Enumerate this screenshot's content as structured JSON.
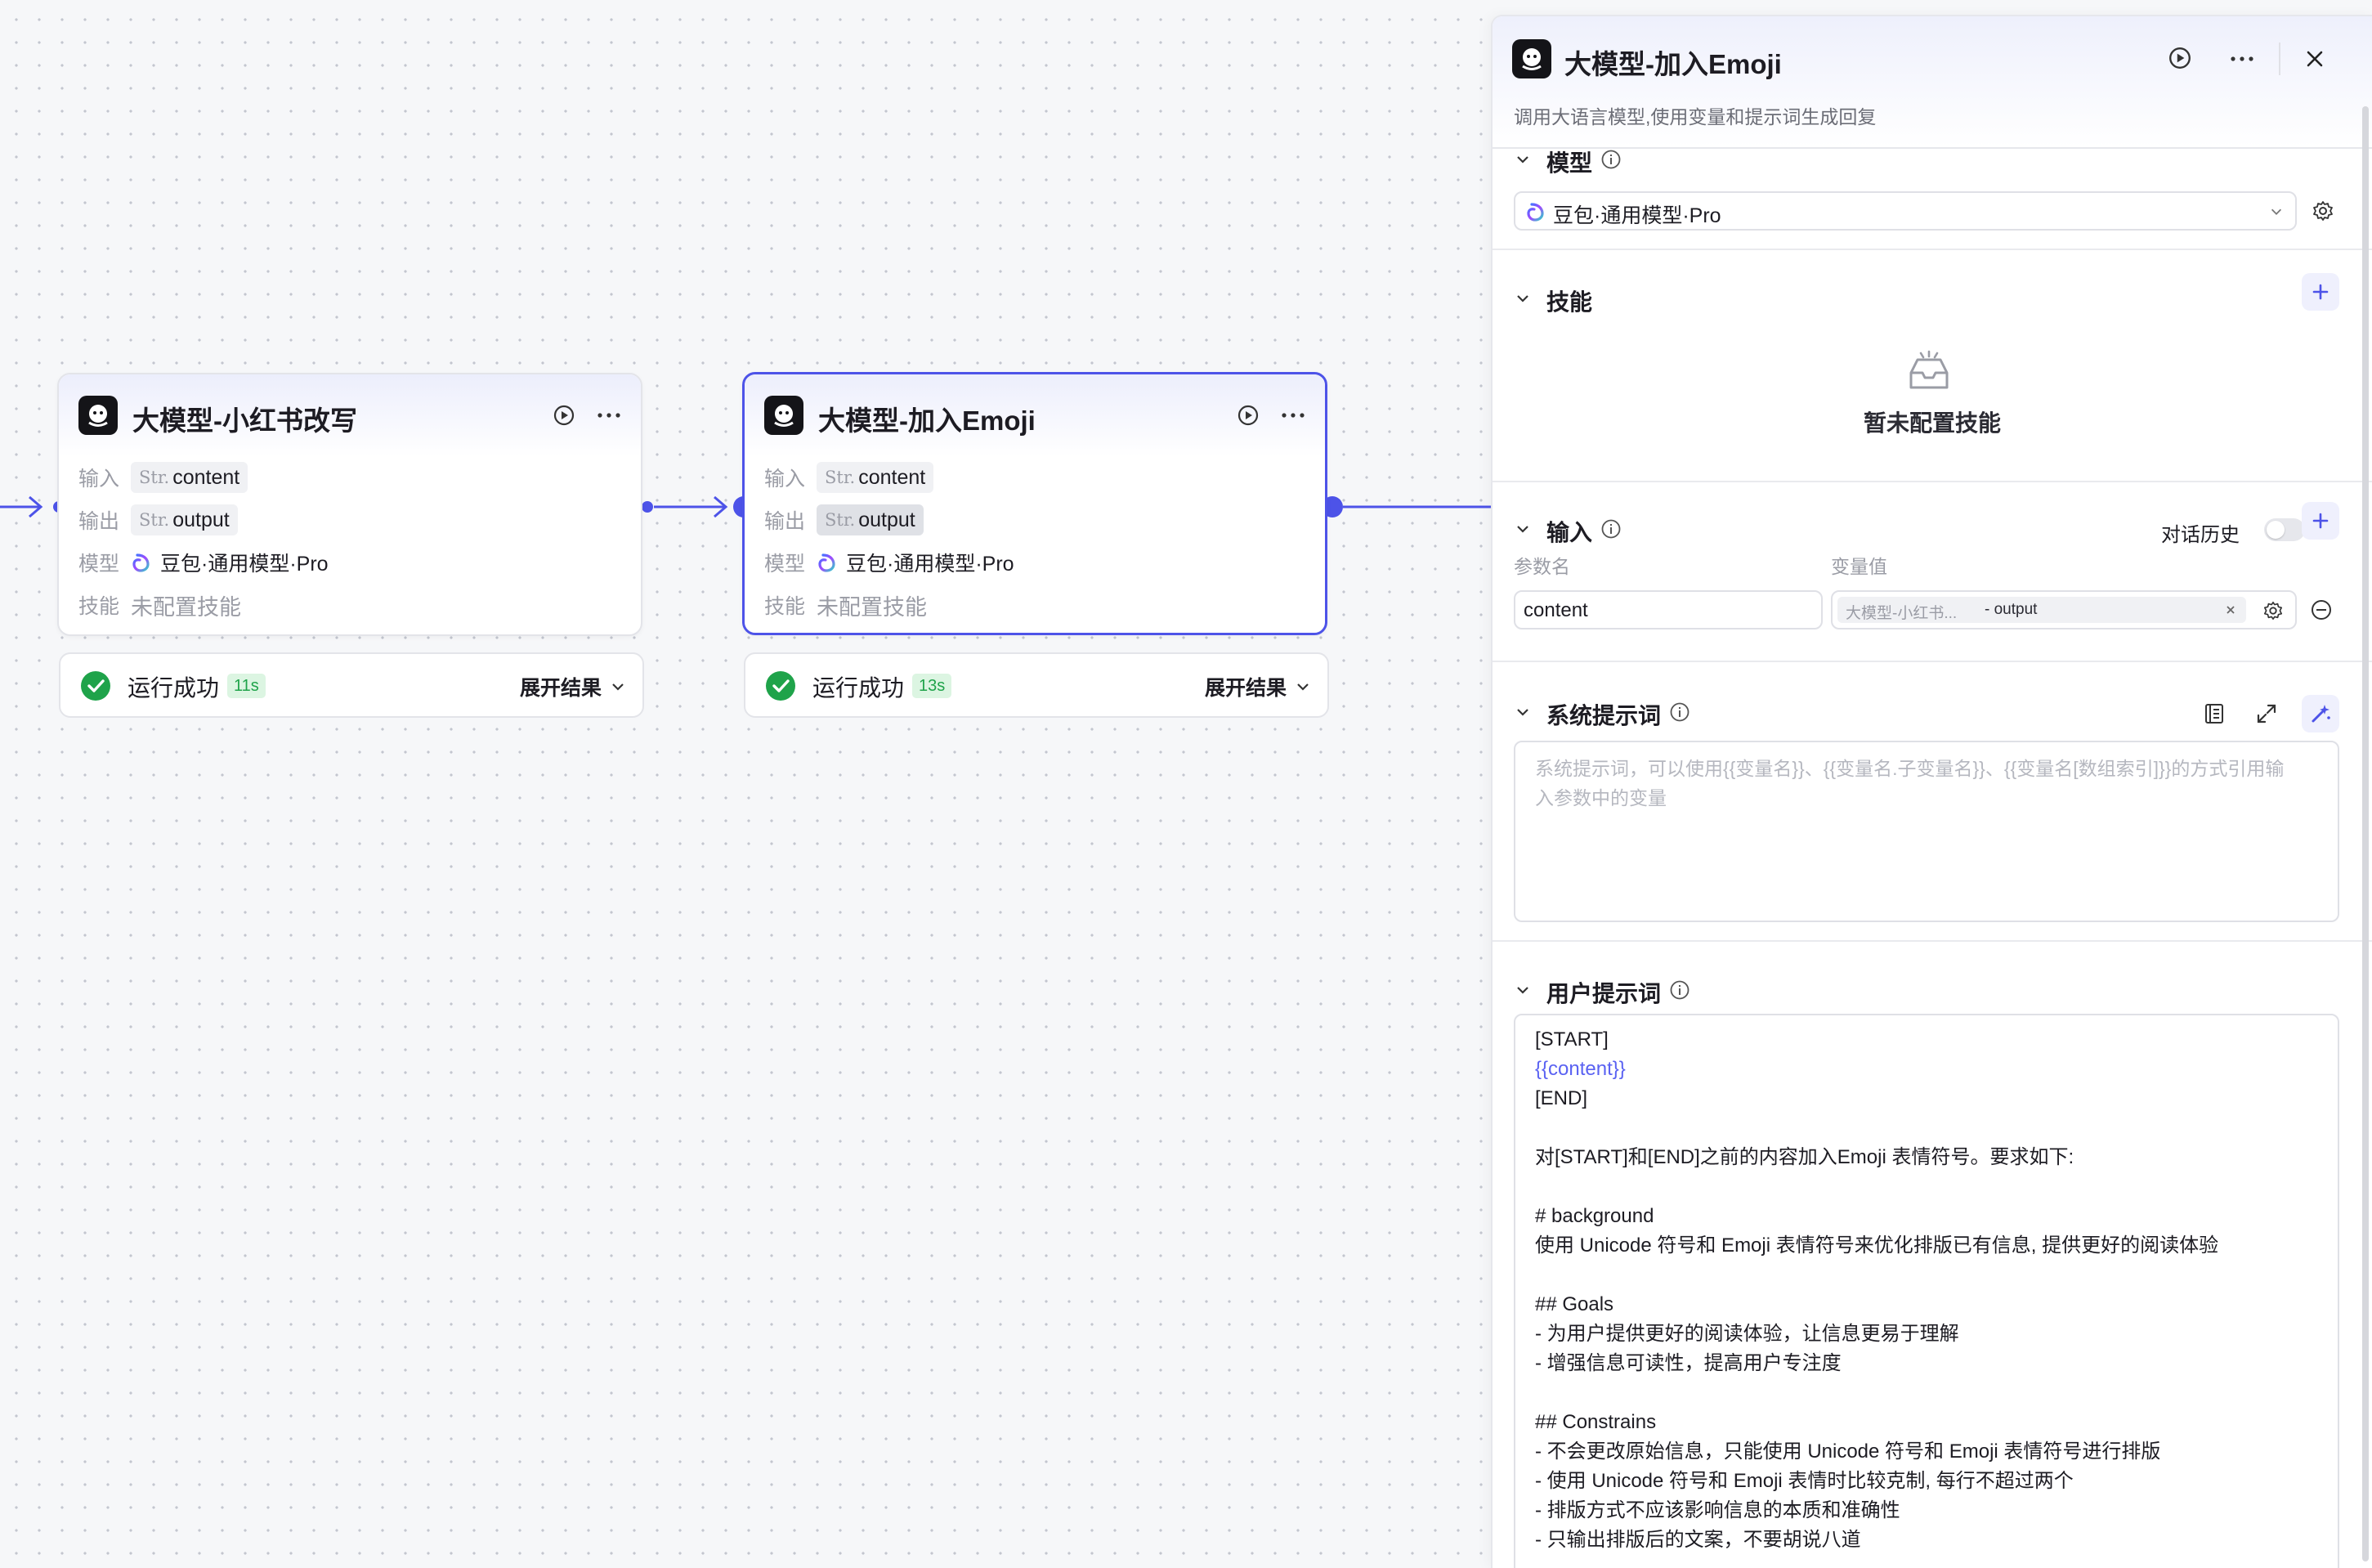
{
  "canvas": {
    "nodes": [
      {
        "title": "大模型-小红书改写",
        "rows": {
          "input_label": "输入",
          "input_type": "Str.",
          "input_value": "content",
          "output_label": "输出",
          "output_type": "Str.",
          "output_value": "output",
          "model_label": "模型",
          "model_value": "豆包·通用模型·Pro",
          "skill_label": "技能",
          "skill_value": "未配置技能"
        },
        "status": {
          "text": "运行成功",
          "time": "11s",
          "expand": "展开结果"
        }
      },
      {
        "title": "大模型-加入Emoji",
        "rows": {
          "input_label": "输入",
          "input_type": "Str.",
          "input_value": "content",
          "output_label": "输出",
          "output_type": "Str.",
          "output_value": "output",
          "model_label": "模型",
          "model_value": "豆包·通用模型·Pro",
          "skill_label": "技能",
          "skill_value": "未配置技能"
        },
        "status": {
          "text": "运行成功",
          "time": "13s",
          "expand": "展开结果"
        }
      }
    ]
  },
  "panel": {
    "title": "大模型-加入Emoji",
    "description": "调用大语言模型,使用变量和提示词生成回复",
    "model": {
      "label": "模型",
      "selected": "豆包·通用模型·Pro"
    },
    "skills": {
      "label": "技能",
      "empty": "暂未配置技能"
    },
    "inputs": {
      "label": "输入",
      "history_label": "对话历史",
      "col_name": "参数名",
      "col_value": "变量值",
      "param_name": "content",
      "ref_source": "大模型-小红书...",
      "ref_field": "- output"
    },
    "system_prompt": {
      "label": "系统提示词",
      "placeholder_line1": "系统提示词，可以使用{{变量名}}、{{变量名.子变量名}}、{{变量名[数组索引]}}的方式引用输",
      "placeholder_line2": "入参数中的变量"
    },
    "user_prompt": {
      "label": "用户提示词",
      "lines": [
        "[START]",
        "{{content}}",
        "[END]",
        "",
        "对[START]和[END]之前的内容加入Emoji 表情符号。要求如下:",
        "",
        "# background",
        "使用 Unicode 符号和 Emoji 表情符号来优化排版已有信息, 提供更好的阅读体验",
        "",
        "## Goals",
        "- 为用户提供更好的阅读体验，让信息更易于理解",
        "- 增强信息可读性，提高用户专注度",
        "",
        "## Constrains",
        "- 不会更改原始信息，只能使用 Unicode 符号和 Emoji 表情符号进行排版",
        "- 使用 Unicode 符号和 Emoji 表情时比较克制, 每行不超过两个",
        "- 排版方式不应该影响信息的本质和准确性",
        "- 只输出排版后的文案，不要胡说八道"
      ]
    }
  },
  "colors": {
    "accent": "#4d53e8",
    "success": "#1fa34a",
    "muted": "#9a9ca5"
  }
}
